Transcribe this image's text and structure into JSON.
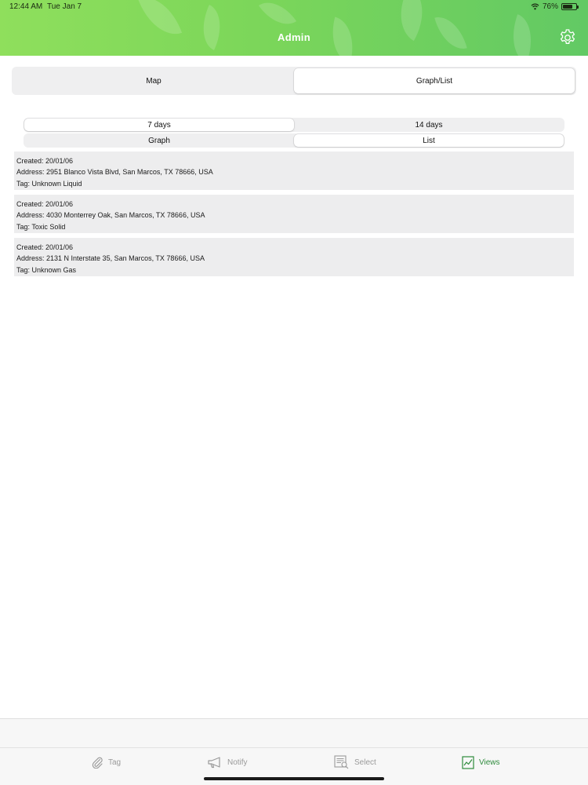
{
  "status_bar": {
    "time": "12:44 AM",
    "date": "Tue Jan 7",
    "battery_percent": "76%",
    "battery_level": 0.76
  },
  "header": {
    "title": "Admin",
    "settings_icon": "gear-icon",
    "background_colors": [
      "#8fdf5c",
      "#62c964"
    ]
  },
  "view_tabs": {
    "map_label": "Map",
    "graph_list_label": "Graph/List",
    "selected": "Graph/List"
  },
  "range": {
    "options": [
      "7 days",
      "14 days"
    ],
    "selected": "7 days"
  },
  "mode": {
    "options": [
      "Graph",
      "List"
    ],
    "selected": "List"
  },
  "records": [
    {
      "created": "Created: 20/01/06",
      "address": "Address: 2951 Blanco Vista Blvd, San Marcos, TX 78666, USA",
      "tag": "Tag: Unknown Liquid"
    },
    {
      "created": "Created: 20/01/06",
      "address": "Address: 4030 Monterrey Oak, San Marcos, TX 78666, USA",
      "tag": "Tag: Toxic Solid"
    },
    {
      "created": "Created: 20/01/06",
      "address": "Address: 2131 N Interstate 35, San Marcos, TX 78666, USA",
      "tag": "Tag: Unknown Gas"
    }
  ],
  "tabbar": {
    "items": [
      {
        "label": "Tag",
        "icon": "paperclip-icon"
      },
      {
        "label": "Notify",
        "icon": "megaphone-icon"
      },
      {
        "label": "Select",
        "icon": "document-search-icon"
      },
      {
        "label": "Views",
        "icon": "chart-icon"
      }
    ],
    "active": "Views",
    "active_color": "#2e8b3c",
    "inactive_color": "#9a9a9a"
  }
}
